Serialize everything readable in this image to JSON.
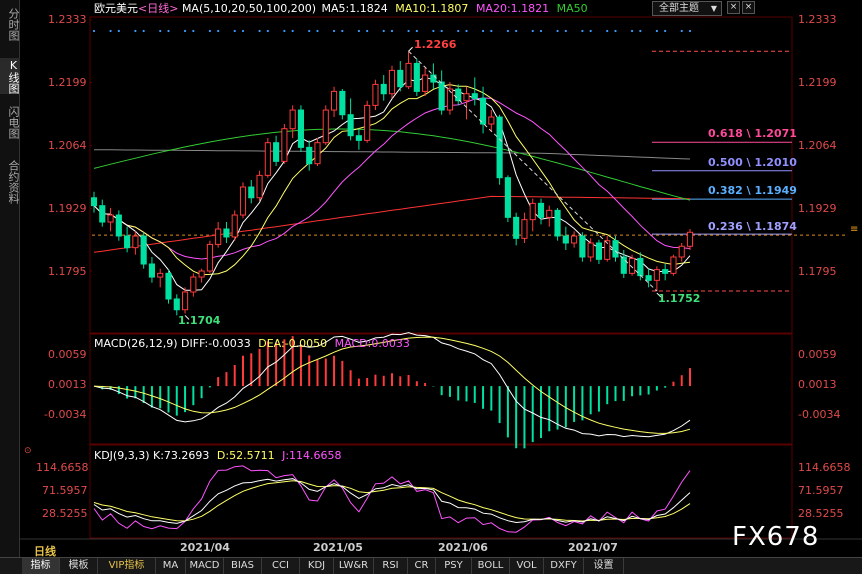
{
  "side_tabs": [
    "分时图",
    "K线图",
    "闪电图",
    "合约资料"
  ],
  "main_legend": {
    "symbol": "欧元美元",
    "period": "<日线>",
    "ma_params": "MA(5,10,20,50,100,200)",
    "ma5": "MA5:1.1824",
    "ma10": "MA10:1.1807",
    "ma20": "MA20:1.1821",
    "ma50": "MA50"
  },
  "theme_select": "全部主题",
  "window_buttons": [
    "×",
    "×"
  ],
  "price_axis": [
    "1.2333",
    "1.2199",
    "1.2064",
    "1.1929",
    "1.1795"
  ],
  "price_axis_values": [
    1.2333,
    1.2199,
    1.2064,
    1.1929,
    1.1795
  ],
  "high_label": "1.2266",
  "low_label_left": "1.1704",
  "low_label_right": "1.1752",
  "fib_levels": [
    {
      "label": "0.618 \\ 1.2071",
      "price": 1.2071,
      "color": "#e04a8a"
    },
    {
      "label": "0.500 \\ 1.2010",
      "price": 1.201,
      "color": "#8a8aff"
    },
    {
      "label": "0.382 \\ 1.1949",
      "price": 1.1949,
      "color": "#5ab0ff"
    },
    {
      "label": "0.236 \\ 1.1874",
      "price": 1.1874,
      "color": "#a0a0ff"
    }
  ],
  "macd_legend": {
    "params": "MACD(26,12,9)",
    "diff": "DIFF:-0.0033",
    "dea": "DEA:-0.0050",
    "macd": "MACD:0.0033"
  },
  "macd_axis": [
    "0.0059",
    "0.0013",
    "-0.0034"
  ],
  "kdj_legend": {
    "params": "KDJ(9,3,3)",
    "k": "K:73.2693",
    "d": "D:52.5711",
    "j": "J:114.6658"
  },
  "kdj_axis": [
    "114.6658",
    "71.5957",
    "28.5255"
  ],
  "period_label": "日线",
  "dates": [
    "2021/04",
    "2021/05",
    "2021/06",
    "2021/07"
  ],
  "bottom_tabs": [
    "指标",
    "模板",
    "VIP指标",
    "MA",
    "MACD",
    "BIAS",
    "CCI",
    "KDJ",
    "LW&R",
    "RSI",
    "CR",
    "PSY",
    "BOLL",
    "VOL",
    "DXFY",
    "设置"
  ],
  "watermark": "FX678",
  "colors": {
    "up": "#ff3b3b",
    "down": "#00e0a0",
    "ma5": "#ffffff",
    "ma10": "#ffff66",
    "ma20": "#ff55ff",
    "ma50": "#33cc33",
    "ma100": "#888888",
    "ma200": "#ff3333",
    "axis_text": "#e04a4a"
  },
  "chart_data": {
    "type": "candlestick",
    "instrument": "EUR/USD",
    "ylim": [
      1.168,
      1.2345
    ],
    "candles": [
      [
        1.1952,
        1.1965,
        1.192,
        1.1935
      ],
      [
        1.1935,
        1.1948,
        1.189,
        1.19
      ],
      [
        1.19,
        1.193,
        1.188,
        1.1915
      ],
      [
        1.1915,
        1.1925,
        1.186,
        1.187
      ],
      [
        1.187,
        1.189,
        1.1835,
        1.1845
      ],
      [
        1.1845,
        1.188,
        1.183,
        1.187
      ],
      [
        1.187,
        1.1878,
        1.18,
        1.181
      ],
      [
        1.181,
        1.1825,
        1.177,
        1.1782
      ],
      [
        1.1782,
        1.18,
        1.176,
        1.179
      ],
      [
        1.179,
        1.1798,
        1.1725,
        1.1735
      ],
      [
        1.1735,
        1.1745,
        1.17,
        1.1712
      ],
      [
        1.1712,
        1.176,
        1.1704,
        1.175
      ],
      [
        1.175,
        1.179,
        1.174,
        1.1782
      ],
      [
        1.1782,
        1.18,
        1.177,
        1.1795
      ],
      [
        1.1795,
        1.186,
        1.179,
        1.1852
      ],
      [
        1.1852,
        1.19,
        1.1845,
        1.1885
      ],
      [
        1.1885,
        1.19,
        1.1855,
        1.1868
      ],
      [
        1.1868,
        1.1925,
        1.186,
        1.1915
      ],
      [
        1.1915,
        1.1985,
        1.1908,
        1.1975
      ],
      [
        1.1975,
        1.199,
        1.194,
        1.1952
      ],
      [
        1.1952,
        1.201,
        1.1945,
        1.2
      ],
      [
        1.2,
        1.208,
        1.1995,
        1.207
      ],
      [
        1.207,
        1.2085,
        1.202,
        1.203
      ],
      [
        1.203,
        1.211,
        1.2025,
        1.21
      ],
      [
        1.21,
        1.215,
        1.208,
        1.214
      ],
      [
        1.214,
        1.215,
        1.205,
        1.206
      ],
      [
        1.206,
        1.2075,
        1.201,
        1.2025
      ],
      [
        1.2025,
        1.208,
        1.202,
        1.207
      ],
      [
        1.207,
        1.215,
        1.2065,
        1.214
      ],
      [
        1.214,
        1.219,
        1.2125,
        1.218
      ],
      [
        1.218,
        1.2185,
        1.212,
        1.213
      ],
      [
        1.213,
        1.2165,
        1.2075,
        1.2085
      ],
      [
        1.2085,
        1.21,
        1.2055,
        1.2075
      ],
      [
        1.2075,
        1.216,
        1.207,
        1.215
      ],
      [
        1.215,
        1.2205,
        1.214,
        1.2195
      ],
      [
        1.2195,
        1.2215,
        1.216,
        1.2175
      ],
      [
        1.2175,
        1.2235,
        1.2165,
        1.2225
      ],
      [
        1.2225,
        1.2245,
        1.218,
        1.219
      ],
      [
        1.219,
        1.2266,
        1.2185,
        1.224
      ],
      [
        1.224,
        1.225,
        1.217,
        1.218
      ],
      [
        1.218,
        1.223,
        1.217,
        1.2215
      ],
      [
        1.2215,
        1.224,
        1.2185,
        1.22
      ],
      [
        1.22,
        1.2225,
        1.213,
        1.214
      ],
      [
        1.214,
        1.22,
        1.213,
        1.2185
      ],
      [
        1.2185,
        1.2195,
        1.215,
        1.216
      ],
      [
        1.216,
        1.219,
        1.212,
        1.2175
      ],
      [
        1.2175,
        1.221,
        1.215,
        1.2165
      ],
      [
        1.2165,
        1.219,
        1.209,
        1.211
      ],
      [
        1.211,
        1.214,
        1.2095,
        1.2125
      ],
      [
        1.2125,
        1.213,
        1.198,
        1.1995
      ],
      [
        1.1995,
        1.2,
        1.19,
        1.191
      ],
      [
        1.191,
        1.192,
        1.185,
        1.1865
      ],
      [
        1.1865,
        1.192,
        1.1855,
        1.1905
      ],
      [
        1.1905,
        1.195,
        1.188,
        1.194
      ],
      [
        1.194,
        1.195,
        1.1895,
        1.191
      ],
      [
        1.191,
        1.1935,
        1.189,
        1.1925
      ],
      [
        1.1925,
        1.193,
        1.186,
        1.187
      ],
      [
        1.187,
        1.189,
        1.184,
        1.1855
      ],
      [
        1.1855,
        1.188,
        1.1845,
        1.187
      ],
      [
        1.187,
        1.1878,
        1.1815,
        1.1825
      ],
      [
        1.1825,
        1.1865,
        1.1815,
        1.1855
      ],
      [
        1.1855,
        1.1862,
        1.181,
        1.182
      ],
      [
        1.182,
        1.187,
        1.1815,
        1.186
      ],
      [
        1.186,
        1.187,
        1.1815,
        1.1825
      ],
      [
        1.1825,
        1.184,
        1.178,
        1.179
      ],
      [
        1.179,
        1.183,
        1.1785,
        1.1822
      ],
      [
        1.1822,
        1.1835,
        1.1775,
        1.1785
      ],
      [
        1.1785,
        1.18,
        1.176,
        1.1775
      ],
      [
        1.1775,
        1.1805,
        1.1752,
        1.1798
      ],
      [
        1.1798,
        1.181,
        1.1775,
        1.179
      ],
      [
        1.179,
        1.183,
        1.1785,
        1.1825
      ],
      [
        1.1825,
        1.1855,
        1.1815,
        1.1848
      ],
      [
        1.1848,
        1.1885,
        1.184,
        1.1878
      ]
    ],
    "macd_ylim": [
      -0.008,
      0.0072
    ]
  }
}
